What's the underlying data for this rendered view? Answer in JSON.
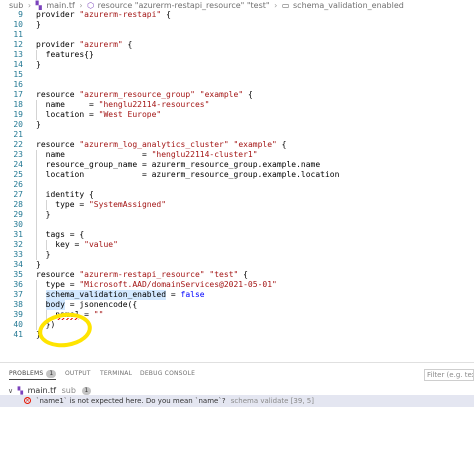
{
  "breadcrumb": {
    "folder": "sub",
    "file": "main.tf",
    "resource": "resource \"azurerm-restapi_resource\" \"test\"",
    "symbol": "schema_validation_enabled"
  },
  "editor": {
    "lines": [
      {
        "n": "9",
        "text": "provider \"azurerm-restapi\" {"
      },
      {
        "n": "10",
        "text": "}"
      },
      {
        "n": "11",
        "text": ""
      },
      {
        "n": "12",
        "text": "provider \"azurerm\" {"
      },
      {
        "n": "13",
        "text": "  features{}"
      },
      {
        "n": "14",
        "text": "}"
      },
      {
        "n": "15",
        "text": ""
      },
      {
        "n": "16",
        "text": ""
      },
      {
        "n": "17",
        "text": "resource \"azurerm_resource_group\" \"example\" {"
      },
      {
        "n": "18",
        "text": "  name     = \"henglu22114-resources\""
      },
      {
        "n": "19",
        "text": "  location = \"West Europe\""
      },
      {
        "n": "20",
        "text": "}"
      },
      {
        "n": "21",
        "text": ""
      },
      {
        "n": "22",
        "text": "resource \"azurerm_log_analytics_cluster\" \"example\" {"
      },
      {
        "n": "23",
        "text": "  name                = \"henglu22114-cluster1\""
      },
      {
        "n": "24",
        "text": "  resource_group_name = azurerm_resource_group.example.name"
      },
      {
        "n": "25",
        "text": "  location            = azurerm_resource_group.example.location"
      },
      {
        "n": "26",
        "text": ""
      },
      {
        "n": "27",
        "text": "  identity {"
      },
      {
        "n": "28",
        "text": "    type = \"SystemAssigned\""
      },
      {
        "n": "29",
        "text": "  }"
      },
      {
        "n": "30",
        "text": ""
      },
      {
        "n": "31",
        "text": "  tags = {"
      },
      {
        "n": "32",
        "text": "    key = \"value\""
      },
      {
        "n": "33",
        "text": "  }"
      },
      {
        "n": "34",
        "text": "}"
      },
      {
        "n": "35",
        "text": "resource \"azurerm-restapi_resource\" \"test\" {"
      },
      {
        "n": "36",
        "text": "  type = \"Microsoft.AAD/domainServices@2021-05-01\""
      },
      {
        "n": "37",
        "text": "  schema_validation_enabled = false"
      },
      {
        "n": "38",
        "text": "  body = jsonencode({"
      },
      {
        "n": "39",
        "text": "    name1 = \"\""
      },
      {
        "n": "40",
        "text": "  })"
      },
      {
        "n": "41",
        "text": "}"
      }
    ]
  },
  "panel": {
    "tabs": [
      {
        "label": "PROBLEMS",
        "badge": "1"
      },
      {
        "label": "OUTPUT"
      },
      {
        "label": "TERMINAL"
      },
      {
        "label": "DEBUG CONSOLE"
      }
    ],
    "filter_placeholder": "Filter (e.g. text, **",
    "problem_file": {
      "name": "main.tf",
      "path": "sub",
      "count": "1"
    },
    "problem": {
      "message": "`name1` is not expected here. Do you mean `name`?",
      "source": "schema validate  [39, 5]"
    }
  },
  "colors": {
    "keyword": "#000000",
    "string": "#a31515",
    "line_number": "#237893",
    "error": "#e51400",
    "annotation": "#ffe400"
  }
}
